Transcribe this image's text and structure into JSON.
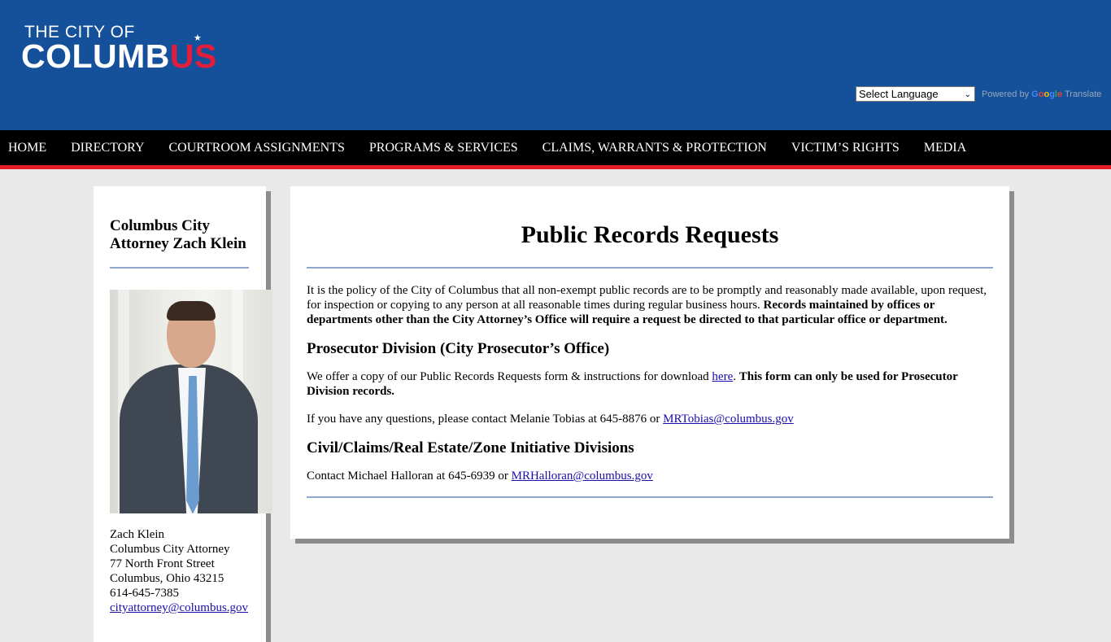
{
  "header": {
    "logo_line1": "THE CITY OF",
    "logo_line2_a": "COLUMB",
    "logo_line2_b": "US",
    "language_select": "Select Language",
    "powered_by": "Powered by",
    "google": [
      "G",
      "o",
      "o",
      "g",
      "l",
      "e"
    ],
    "translate": "Translate"
  },
  "nav": {
    "items": [
      "HOME",
      "DIRECTORY",
      "COURTROOM ASSIGNMENTS",
      "PROGRAMS & SERVICES",
      "CLAIMS, WARRANTS & PROTECTION",
      "VICTIM’S RIGHTS",
      "MEDIA"
    ]
  },
  "sidebar": {
    "title": "Columbus City Attorney Zach Klein",
    "contact": {
      "name": "Zach Klein",
      "role": "Columbus City Attorney",
      "street": "77 North Front Street",
      "city": "Columbus, Ohio 43215",
      "phone": "614-645-7385",
      "email": "cityattorney@columbus.gov"
    }
  },
  "main": {
    "title": "Public Records Requests",
    "intro_text": "It is the policy of the City of Columbus that all non-exempt public records are to be promptly and reasonably made available, upon request, for inspection or copying to any person at all reasonable times during regular business hours. ",
    "intro_bold": "Records maintained by offices or departments other than the City Attorney’s Office will require a request be directed to that particular office or department.",
    "prosecutor_heading": "Prosecutor Division (City Prosecutor’s Office)",
    "prosecutor_text": "We offer a copy of our Public Records Requests form & instructions for download ",
    "prosecutor_link": "here",
    "prosecutor_period": ". ",
    "prosecutor_bold": "This form can only be used for Prosecutor Division records.",
    "questions_text": "If you have any questions, please contact Melanie Tobias at 645-8876 or ",
    "questions_email": "MRTobias@columbus.gov",
    "civil_heading": "Civil/Claims/Real Estate/Zone Initiative Divisions",
    "civil_text": "Contact Michael Halloran at 645-6939 or ",
    "civil_email": "MRHalloran@columbus.gov"
  },
  "colors": {
    "header_blue": "#15519a",
    "nav_black": "#000000",
    "nav_red_stripe": "#e31d25",
    "logo_red": "#e31d3c",
    "divider_blue": "#8fa6cc"
  }
}
